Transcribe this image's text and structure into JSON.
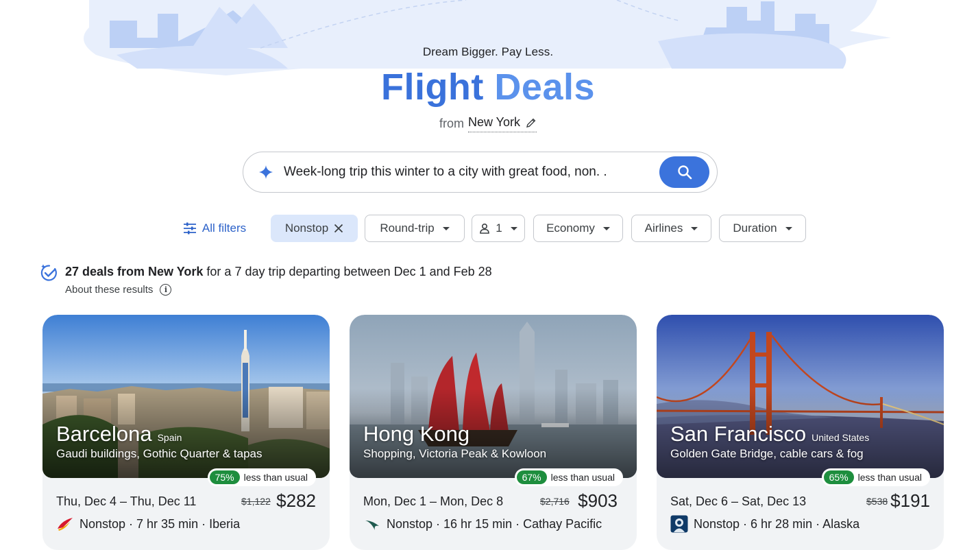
{
  "header": {
    "tagline": "Dream Bigger. Pay Less.",
    "title_part1": "Flight",
    "title_part2": "Deals",
    "from_label": "from",
    "origin_city": "New York"
  },
  "search": {
    "query": "Week-long trip this winter to a city with great food, non. ."
  },
  "filters": {
    "all_filters": "All filters",
    "nonstop": "Nonstop",
    "trip_type": "Round-trip",
    "passengers": "1",
    "cabin": "Economy",
    "airlines": "Airlines",
    "duration": "Duration"
  },
  "summary": {
    "deals_count_text": "27 deals from New York",
    "rest_text": " for a 7 day trip departing between Dec 1 and Feb 28",
    "about": "About these results"
  },
  "cards": [
    {
      "city": "Barcelona",
      "country": "Spain",
      "description": "Gaudi buildings, Gothic Quarter & tapas",
      "deal_percent": "75%",
      "deal_text": "less than usual",
      "dates": "Thu, Dec 4 – Thu, Dec 11",
      "usual_price": "$1,122",
      "price": "$282",
      "flight_info": "Nonstop · 7 hr 35 min · Iberia",
      "airline_icon": "iberia-logo-icon"
    },
    {
      "city": "Hong Kong",
      "country": "",
      "description": "Shopping, Victoria Peak & Kowloon",
      "deal_percent": "67%",
      "deal_text": "less than usual",
      "dates": "Mon, Dec 1 – Mon, Dec 8",
      "usual_price": "$2,716",
      "price": "$903",
      "flight_info": "Nonstop · 16 hr 15 min · Cathay Pacific",
      "airline_icon": "cathay-pacific-logo-icon"
    },
    {
      "city": "San Francisco",
      "country": "United States",
      "description": "Golden Gate Bridge, cable cars & fog",
      "deal_percent": "65%",
      "deal_text": "less than usual",
      "dates": "Sat, Dec 6 – Sat, Dec 13",
      "usual_price": "$538",
      "price": "$191",
      "flight_info": "Nonstop · 6 hr 28 min · Alaska",
      "airline_icon": "alaska-logo-icon"
    }
  ],
  "colors": {
    "accent": "#3b73dc",
    "title_blue": "#3a72db",
    "deal_green": "#1e8e3e",
    "chip_active_bg": "#dbe7fb",
    "card_bg": "#f1f3f5"
  }
}
